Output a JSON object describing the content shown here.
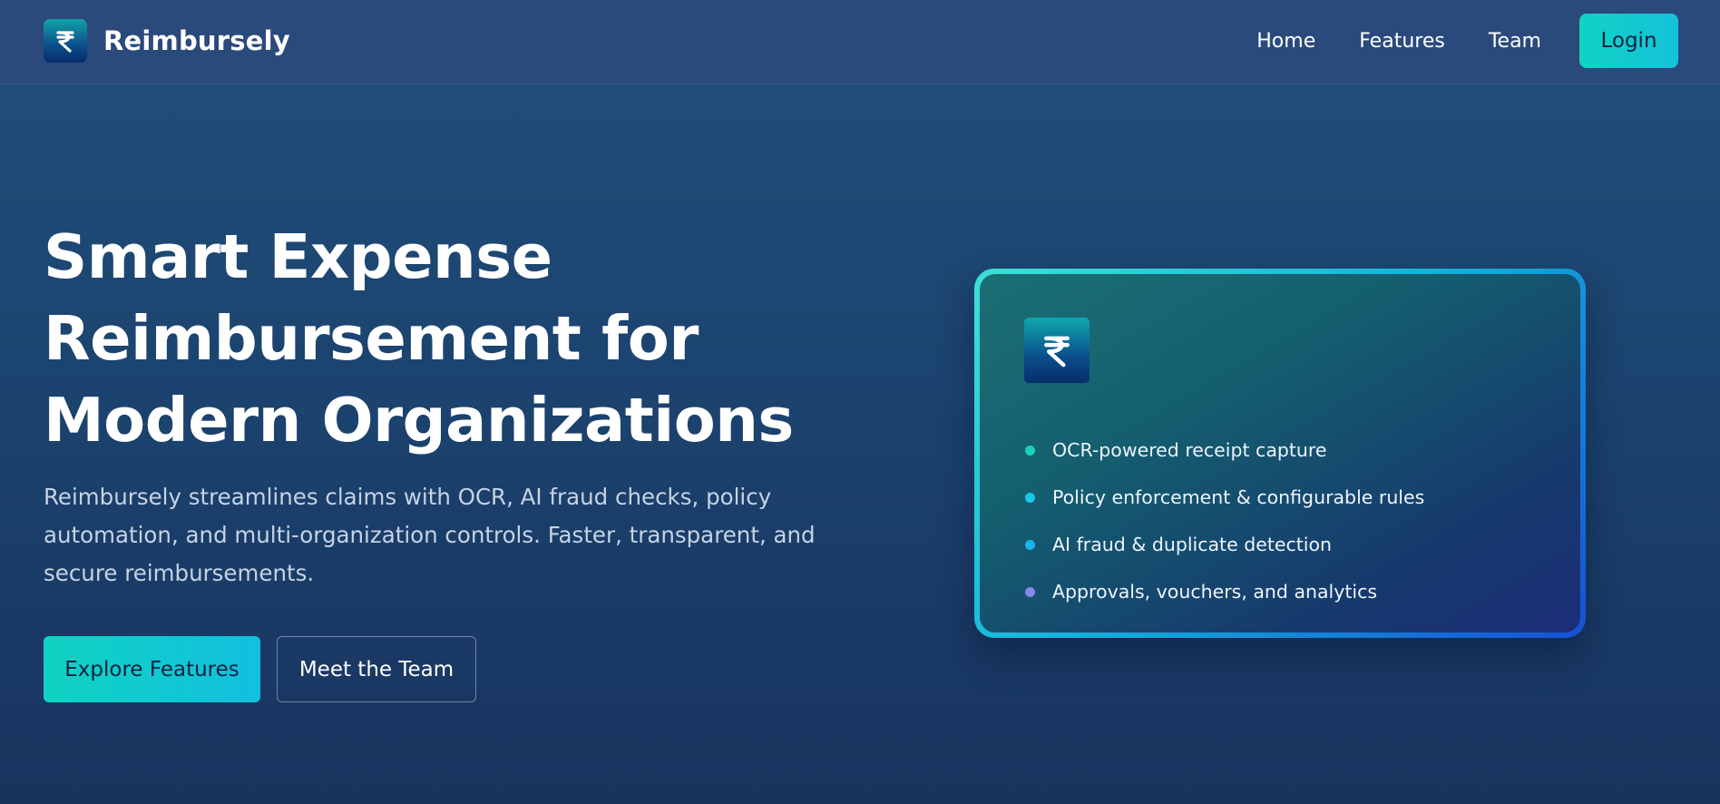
{
  "brand": {
    "name": "Reimbursely",
    "logo_icon": "rupee-icon"
  },
  "nav": {
    "links": [
      "Home",
      "Features",
      "Team"
    ],
    "login_label": "Login"
  },
  "hero": {
    "title_lines": [
      "Smart Expense",
      "Reimbursement for",
      "Modern Organizations"
    ],
    "subtitle_lines": [
      "Reimbursely streamlines claims with OCR, AI fraud checks, policy",
      "automation, and multi-organization controls. Faster, transparent, and",
      "secure reimbursements."
    ],
    "primary_button": "Explore Features",
    "secondary_button": "Meet the Team"
  },
  "card": {
    "logo_icon": "rupee-icon",
    "features": [
      {
        "label": "OCR-powered receipt capture",
        "dot_color": "#1bd1b8"
      },
      {
        "label": "Policy enforcement & configurable rules",
        "dot_color": "#19c6e6"
      },
      {
        "label": "AI fraud & duplicate detection",
        "dot_color": "#16b4ee"
      },
      {
        "label": "Approvals, vouchers, and analytics",
        "dot_color": "#8a86f0"
      }
    ]
  },
  "colors": {
    "accent": "#12d2c3",
    "background_top": "#21507a",
    "background_bottom": "#18335e",
    "navbar": "#2b4a7c"
  }
}
